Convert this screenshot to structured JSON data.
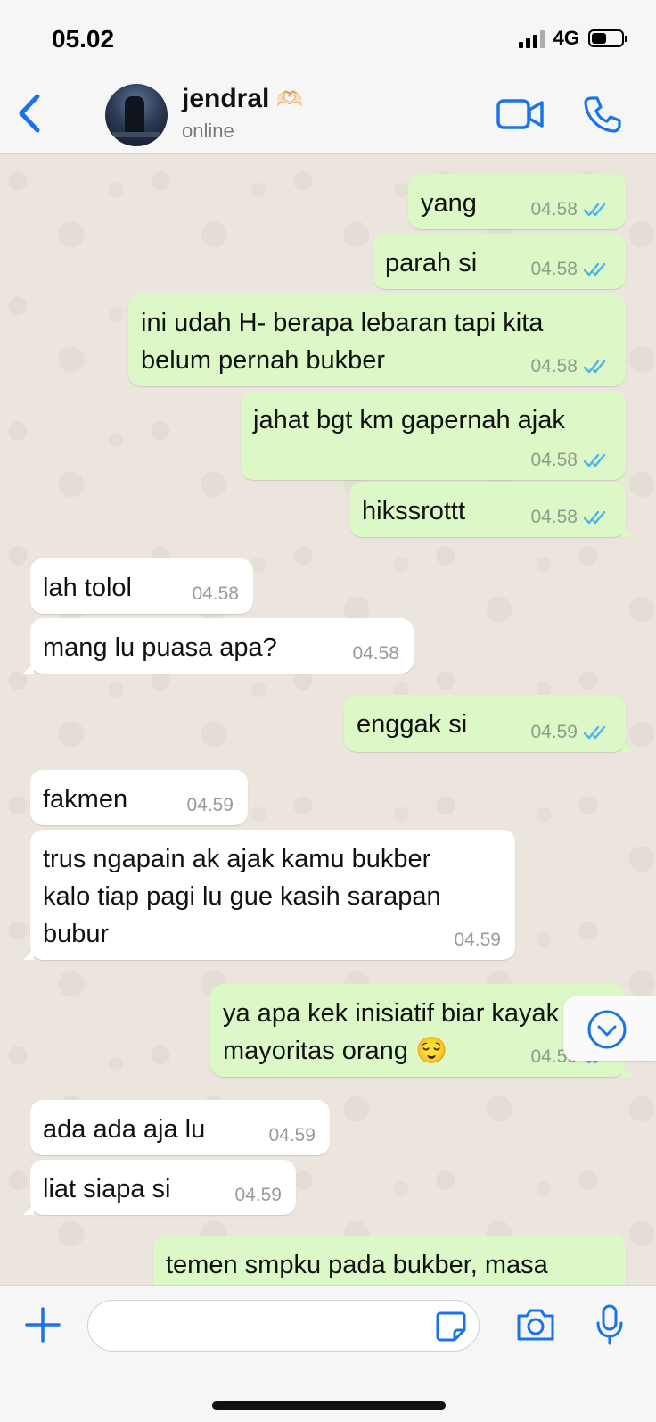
{
  "status_bar": {
    "time": "05.02",
    "network": "4G",
    "battery_level": 0.5
  },
  "header": {
    "contact_name": "jendral",
    "name_emoji": "🫶🏻",
    "status": "online",
    "accent_color": "#1a73e8"
  },
  "messages": [
    {
      "dir": "out",
      "lines": [
        "yang"
      ],
      "time": "04.58",
      "read": true
    },
    {
      "dir": "out",
      "lines": [
        "parah si"
      ],
      "time": "04.58",
      "read": true
    },
    {
      "dir": "out",
      "lines": [
        "ini udah H- berapa lebaran tapi kita",
        "belum pernah bukber"
      ],
      "time": "04.58",
      "read": true
    },
    {
      "dir": "out",
      "lines": [
        "jahat bgt km gapernah ajak"
      ],
      "time": "04.58",
      "read": true
    },
    {
      "dir": "out",
      "lines": [
        "hikssrottt"
      ],
      "time": "04.58",
      "read": true
    },
    {
      "dir": "in",
      "lines": [
        "lah tolol"
      ],
      "time": "04.58"
    },
    {
      "dir": "in",
      "lines": [
        "mang lu puasa apa?"
      ],
      "time": "04.58"
    },
    {
      "dir": "out",
      "lines": [
        "enggak si"
      ],
      "time": "04.59",
      "read": true
    },
    {
      "dir": "in",
      "lines": [
        "fakmen"
      ],
      "time": "04.59"
    },
    {
      "dir": "in",
      "lines": [
        "trus ngapain ak ajak kamu bukber",
        "kalo tiap pagi lu gue kasih sarapan",
        "bubur"
      ],
      "time": "04.59"
    },
    {
      "dir": "out",
      "lines": [
        "ya apa kek inisiatif biar kayak",
        "mayoritas orang 😌"
      ],
      "time": "04.59",
      "read": true
    },
    {
      "dir": "in",
      "lines": [
        "ada ada aja lu"
      ],
      "time": "04.59"
    },
    {
      "dir": "in",
      "lines": [
        "liat siapa si"
      ],
      "time": "04.59"
    },
    {
      "dir": "out",
      "lines": [
        "temen smpku pada bukber, masa"
      ],
      "time": "",
      "read": false,
      "partial": true
    }
  ],
  "composer": {
    "input_value": "",
    "input_placeholder": ""
  },
  "colors": {
    "outgoing_bubble": "#dcf8c6",
    "incoming_bubble": "#ffffff",
    "chat_background": "#ebe5dd",
    "read_ticks": "#4fb3e8"
  }
}
